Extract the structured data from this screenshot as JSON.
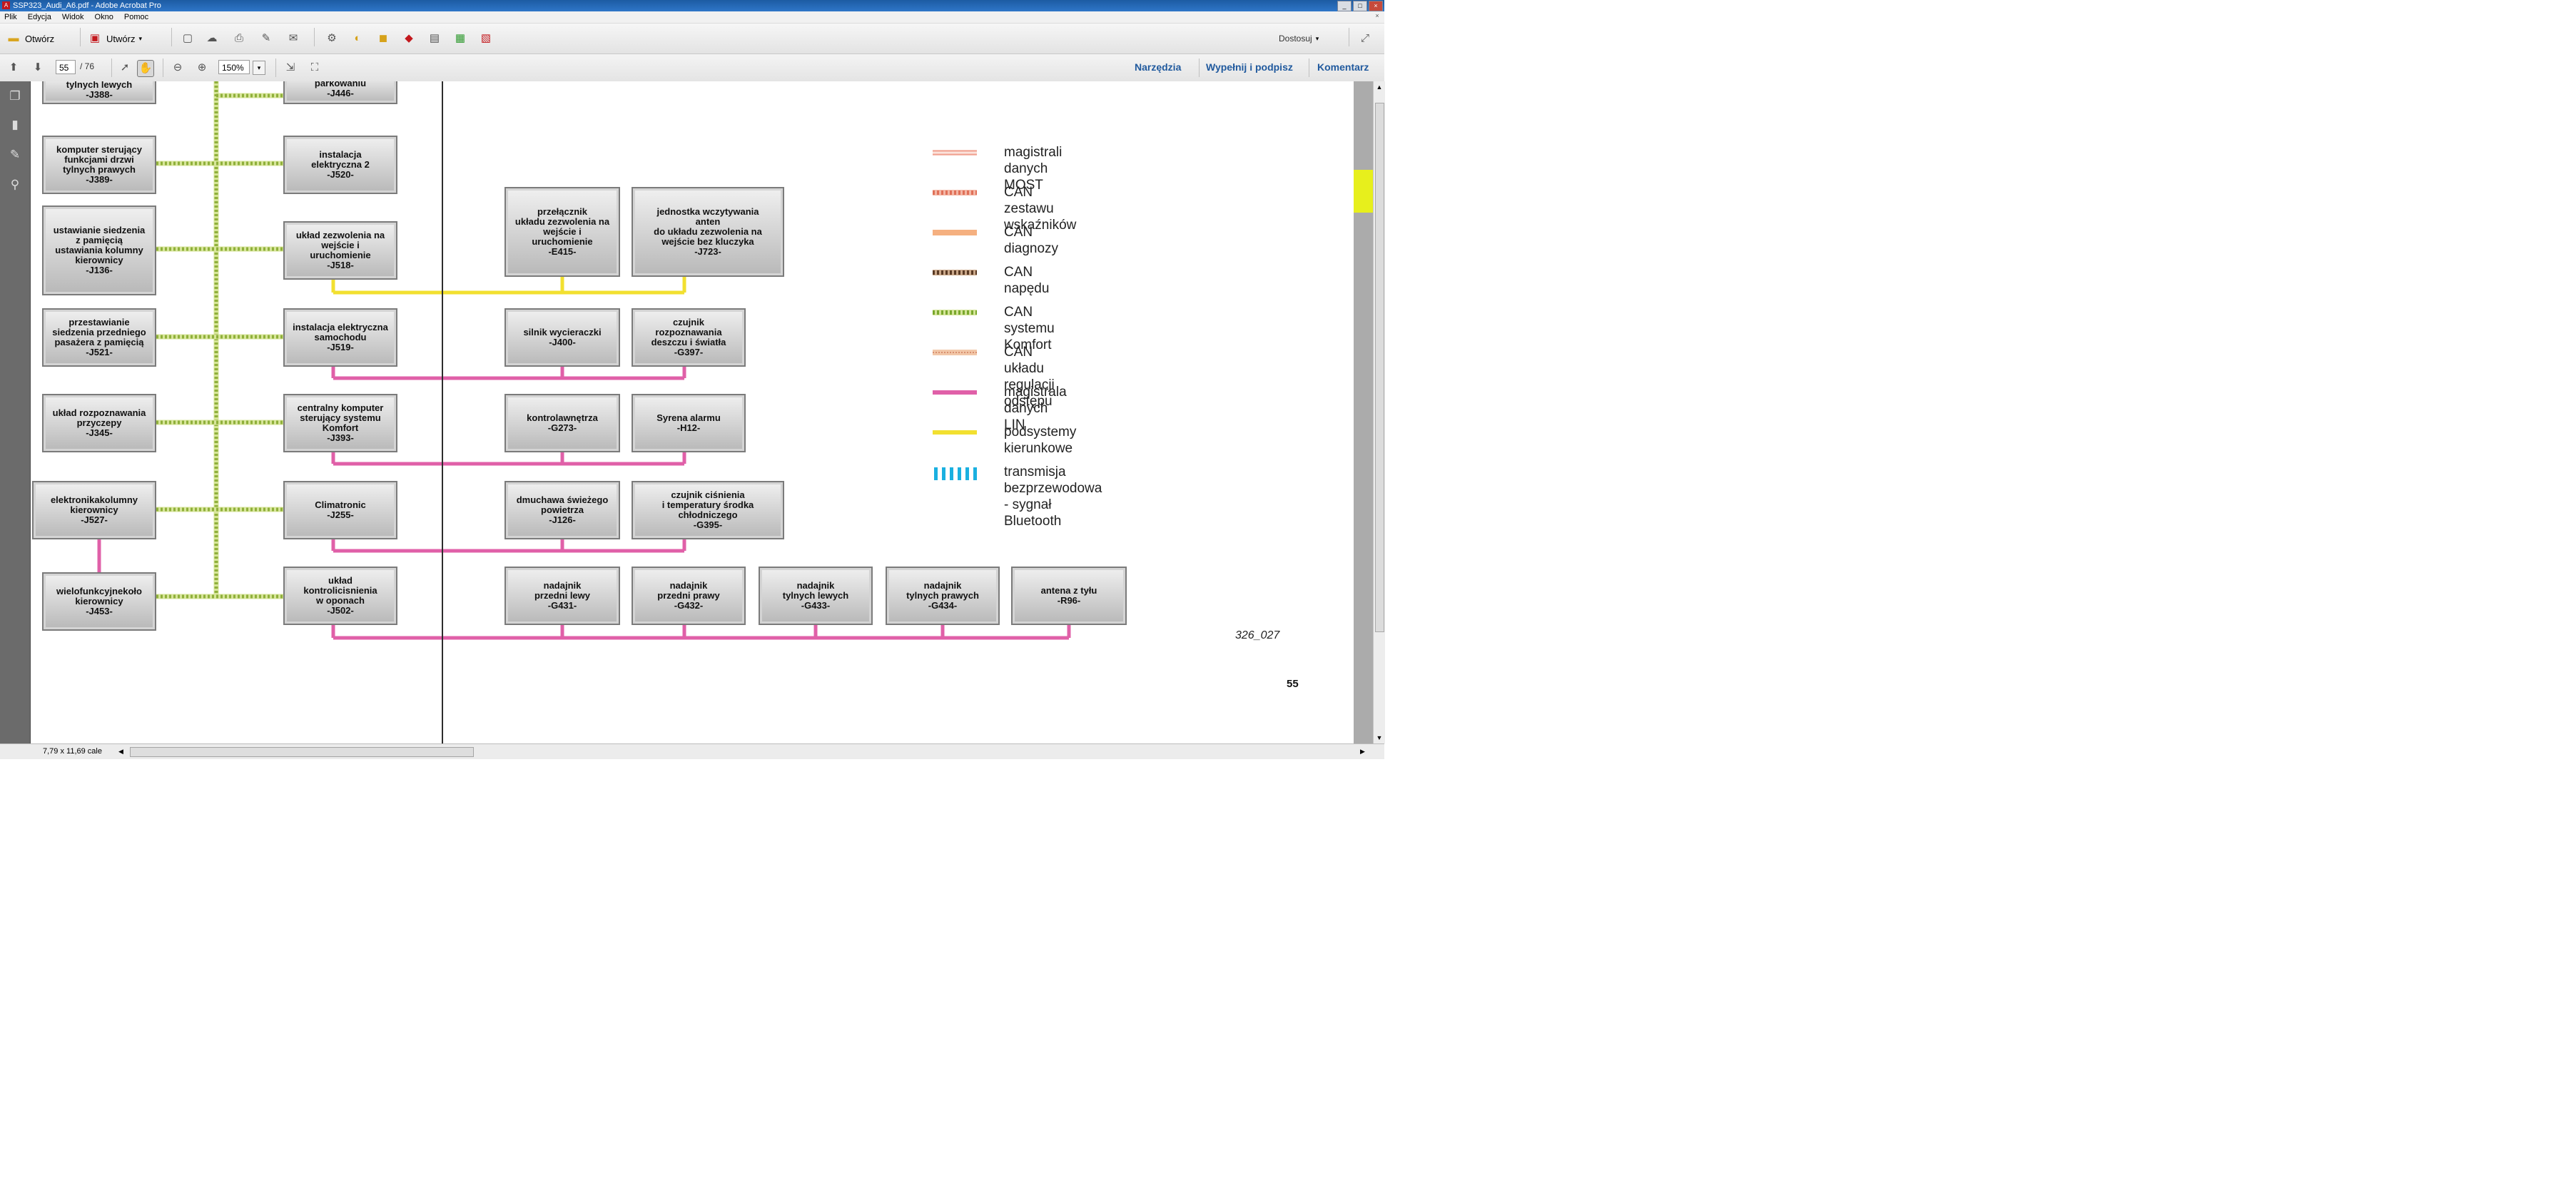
{
  "window": {
    "title": "SSP323_Audi_A6.pdf - Adobe Acrobat Pro",
    "app_icon": "acrobat-icon",
    "min": "_",
    "max": "□",
    "close": "×"
  },
  "menu": {
    "items": [
      "Plik",
      "Edycja",
      "Widok",
      "Okno",
      "Pomoc"
    ]
  },
  "toolbar": {
    "open_label": "Otwórz",
    "create_label": "Utwórz",
    "fit_label": "Dostosuj"
  },
  "nav": {
    "page_current": "55",
    "page_total": "/ 76",
    "zoom": "150%",
    "tools_link": "Narzędzia",
    "sign_link": "Wypełnij i podpisz",
    "comment_link": "Komentarz"
  },
  "status": {
    "size": "7,79 x 11,69 cale"
  },
  "diagram": {
    "boxes": [
      {
        "id": "j388",
        "text": "tylnych lewych\n-J388-"
      },
      {
        "id": "j446",
        "text": "parkowaniu\n-J446-"
      },
      {
        "id": "j389",
        "text": "komputer sterujący\nfunkcjami drzwi\ntylnych prawych\n-J389-"
      },
      {
        "id": "j520",
        "text": "instalacja\nelektryczna 2\n-J520-"
      },
      {
        "id": "j136",
        "text": "ustawianie siedzenia\nz pamięcią\nustawiania kolumny\nkierownicy\n-J136-"
      },
      {
        "id": "j518",
        "text": "układ zezwolenia na\nwejście i\nuruchomienie\n-J518-"
      },
      {
        "id": "e415",
        "text": "przełącznik\nukładu zezwolenia na\nwejście i\nuruchomienie\n-E415-"
      },
      {
        "id": "j723",
        "text": "jednostka wczytywania\nanten\ndo układu zezwolenia na\nwejście bez kluczyka\n-J723-"
      },
      {
        "id": "j521",
        "text": "przestawianie\nsiedzenia przedniego\npasażera z pamięcią\n-J521-"
      },
      {
        "id": "j519",
        "text": "instalacja elektryczna\nsamochodu\n-J519-"
      },
      {
        "id": "j400",
        "text": "silnik wycieraczki\n-J400-"
      },
      {
        "id": "g397",
        "text": "czujnik\nrozpoznawania\ndeszczu i światła\n-G397-"
      },
      {
        "id": "j345",
        "text": "układ rozpoznawania\nprzyczepy\n-J345-"
      },
      {
        "id": "j393",
        "text": "centralny komputer\nsterujący systemu\nKomfort\n-J393-"
      },
      {
        "id": "g273",
        "text": "kontrolawnętrza\n-G273-"
      },
      {
        "id": "h12",
        "text": "Syrena alarmu\n-H12-"
      },
      {
        "id": "j527",
        "text": "elektronikakolumny\nkierownicy\n-J527-"
      },
      {
        "id": "j255",
        "text": "Climatronic\n-J255-"
      },
      {
        "id": "j126",
        "text": "dmuchawa świeżego\npowietrza\n-J126-"
      },
      {
        "id": "g395",
        "text": "czujnik ciśnienia\ni temperatury środka\nchłodniczego\n-G395-"
      },
      {
        "id": "j453",
        "text": "wielofunkcyjnekoło\nkierownicy\n-J453-"
      },
      {
        "id": "j502",
        "text": "układ\nkontrolicisnienia\nw oponach\n-J502-"
      },
      {
        "id": "g431",
        "text": "nadajnik\nprzedni lewy\n-G431-"
      },
      {
        "id": "g432",
        "text": "nadajnik\nprzedni prawy\n-G432-"
      },
      {
        "id": "g433",
        "text": "nadajnik\ntylnych lewych\n-G433-"
      },
      {
        "id": "g434",
        "text": "nadajnik\ntylnych prawych\n-G434-"
      },
      {
        "id": "r96",
        "text": "antena z tyłu\n-R96-"
      }
    ],
    "legend": [
      {
        "label": "magistrali danych MOST",
        "color": "#f0a090",
        "pattern": "double"
      },
      {
        "label": "CAN zestawu wskaźników",
        "color": "#e07058",
        "pattern": "hatch"
      },
      {
        "label": "CAN diagnozy",
        "color": "#f5b080",
        "pattern": "solid"
      },
      {
        "label": "CAN napędu",
        "color": "#8a5a3c",
        "pattern": "hatch"
      },
      {
        "label": "CAN systemu Komfort",
        "color": "#9bc43c",
        "pattern": "hatch"
      },
      {
        "label": "CAN układu regulacji odstępu",
        "color": "#e8b090",
        "pattern": "dotted"
      },
      {
        "label": "magistrala danych LIN",
        "color": "#e060a8",
        "pattern": "solid"
      },
      {
        "label": "podsystemy kierunkowe",
        "color": "#f2e030",
        "pattern": "solid"
      },
      {
        "label": "transmisja bezprzewodowa\n- sygnał Bluetooth",
        "color": "#1ab0e0",
        "pattern": "dashed"
      }
    ],
    "figure_ref": "326_027",
    "page_number": "55",
    "colors": {
      "lin": "#e060a8",
      "komfort": "#b8cf52",
      "yellow": "#f2e030",
      "highlight": "#e7ef1c"
    }
  }
}
